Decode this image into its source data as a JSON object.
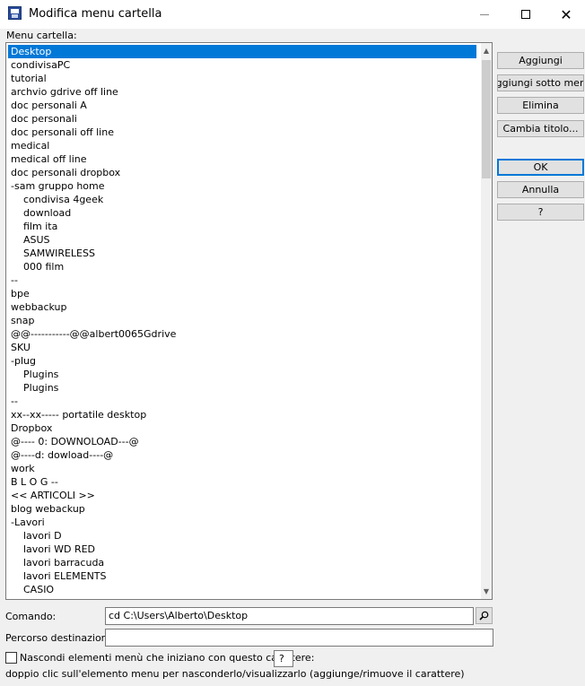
{
  "window": {
    "title": "Modifica menu cartella",
    "icon": "save-disk-icon"
  },
  "list": {
    "label": "Menu cartella:",
    "items": [
      {
        "label": "Desktop",
        "indent": false,
        "selected": true
      },
      {
        "label": "condivisaPC",
        "indent": false
      },
      {
        "label": "tutorial",
        "indent": false
      },
      {
        "label": "archvio gdrive off line",
        "indent": false
      },
      {
        "label": "doc personali A",
        "indent": false
      },
      {
        "label": "doc personali",
        "indent": false
      },
      {
        "label": "doc personali off line",
        "indent": false
      },
      {
        "label": "medical",
        "indent": false
      },
      {
        "label": "medical off line",
        "indent": false
      },
      {
        "label": "doc personali  dropbox",
        "indent": false
      },
      {
        "label": "-sam gruppo home",
        "indent": false
      },
      {
        "label": "condivisa 4geek",
        "indent": true
      },
      {
        "label": "download",
        "indent": true
      },
      {
        "label": "film ita",
        "indent": true
      },
      {
        "label": "ASUS",
        "indent": true
      },
      {
        "label": "SAMWIRELESS",
        "indent": true
      },
      {
        "label": "000 film",
        "indent": true
      },
      {
        "label": "--",
        "indent": false
      },
      {
        "label": "bpe",
        "indent": false
      },
      {
        "label": "webbackup",
        "indent": false
      },
      {
        "label": "snap",
        "indent": false
      },
      {
        "label": "@@-----------@@albert0065Gdrive",
        "indent": false
      },
      {
        "label": "SKU",
        "indent": false
      },
      {
        "label": "-plug",
        "indent": false
      },
      {
        "label": "Plugins",
        "indent": true
      },
      {
        "label": "Plugins",
        "indent": true
      },
      {
        "label": "--",
        "indent": false
      },
      {
        "label": "xx--xx----- portatile desktop",
        "indent": false
      },
      {
        "label": "Dropbox",
        "indent": false
      },
      {
        "label": "@---- 0: DOWNOLOAD---@",
        "indent": false
      },
      {
        "label": "@----d: dowload----@",
        "indent": false
      },
      {
        "label": "work",
        "indent": false
      },
      {
        "label": "B L O G --",
        "indent": false
      },
      {
        "label": "<< ARTICOLI >>",
        "indent": false
      },
      {
        "label": "blog webackup",
        "indent": false
      },
      {
        "label": "-Lavori",
        "indent": false
      },
      {
        "label": "lavori  D",
        "indent": true
      },
      {
        "label": "lavori WD RED",
        "indent": true
      },
      {
        "label": "lavori barracuda",
        "indent": true
      },
      {
        "label": "lavori ELEMENTS",
        "indent": true
      },
      {
        "label": "CASIO",
        "indent": true
      },
      {
        "label": "...",
        "indent": true
      }
    ]
  },
  "buttons": {
    "add": "Aggiungi",
    "add_submenu": "Aggiungi sotto menu",
    "delete": "Elimina",
    "rename": "Cambia titolo...",
    "ok": "OK",
    "cancel": "Annulla",
    "help": "?"
  },
  "command": {
    "label": "Comando:",
    "value": "cd C:\\Users\\Alberto\\Desktop"
  },
  "destination": {
    "label": "Percorso destinazione:",
    "value": ""
  },
  "hide": {
    "label": "Nascondi elementi menù che iniziano con questo carattere:",
    "char": "?",
    "checked": false
  },
  "hint": "doppio clic sull'elemento menu per nasconderlo/visualizzarlo (aggiunge/rimuove il carattere)",
  "colors": {
    "selection": "#0078d7",
    "default_button_border": "#0078d7"
  }
}
